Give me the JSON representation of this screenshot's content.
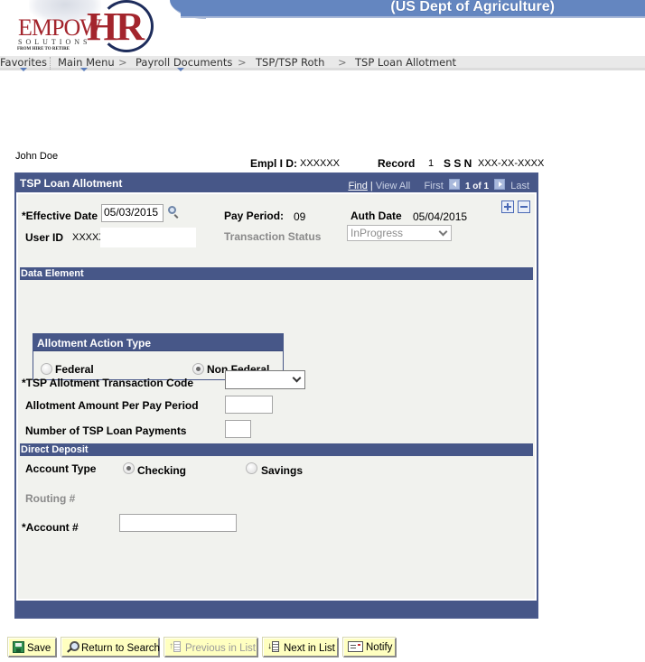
{
  "banner": {
    "title": "(US Dept of Agriculture)",
    "logo": {
      "brand_main": "EMPOW",
      "brand_hr": "HR",
      "brand_sub": "SOLUTIONS",
      "tagline": "FROM HIRE TO RETIRE"
    },
    "colors": {
      "banner_blue": "#6486c0",
      "logo_red": "#a3252d",
      "logo_navy": "#1e2d5c"
    }
  },
  "nav": {
    "items": [
      {
        "label": "Favorites",
        "has_dropdown": true
      },
      {
        "label": "Main Menu",
        "has_dropdown": true
      },
      {
        "label": "Payroll Documents",
        "has_dropdown": true
      },
      {
        "label": "TSP/TSP Roth",
        "has_dropdown": false
      },
      {
        "label": "TSP Loan Allotment",
        "has_dropdown": false
      }
    ],
    "separator": ">"
  },
  "employee": {
    "name": "John Doe",
    "empl_id_label": "Empl I D:",
    "empl_id": "XXXXXX",
    "record_label": "Record",
    "record": "1",
    "ssn_label": "S S N",
    "ssn": "XXX-XX-XXXX"
  },
  "panel": {
    "title": "TSP Loan Allotment",
    "find": "Find",
    "view_all": "View All",
    "first": "First",
    "count": "1 of 1",
    "last": "Last",
    "colors": {
      "header": "#475788",
      "body": "#f1f2ee"
    }
  },
  "form": {
    "effective_date_label": "*Effective Date",
    "effective_date": "05/03/2015",
    "pay_period_label": "Pay Period:",
    "pay_period": "09",
    "auth_date_label": "Auth Date",
    "auth_date": "05/04/2015",
    "user_id_label": "User ID",
    "user_id": "XXXXXX",
    "transaction_status_label": "Transaction Status",
    "transaction_status": "InProgress",
    "data_element_section": "Data Element",
    "allotment_action_type": {
      "title": "Allotment Action Type",
      "options": [
        {
          "label": "Federal",
          "checked": false
        },
        {
          "label": "Non Federal",
          "checked": true
        }
      ]
    },
    "tsp_code_label": "*TSP Allotment Transaction Code",
    "tsp_code": "",
    "amount_label": "Allotment Amount Per Pay Period",
    "amount": "",
    "num_payments_label": "Number of TSP Loan Payments",
    "num_payments": "",
    "direct_deposit_section": "Direct Deposit",
    "account_type_label": "Account Type",
    "account_types": [
      {
        "label": "Checking",
        "checked": true
      },
      {
        "label": "Savings",
        "checked": false
      }
    ],
    "routing_label": "Routing #",
    "account_label": "*Account #",
    "account": ""
  },
  "toolbar": {
    "save": "Save",
    "return_to_search": "Return to Search",
    "previous_in_list": "Previous in List",
    "next_in_list": "Next in List",
    "notify": "Notify"
  }
}
